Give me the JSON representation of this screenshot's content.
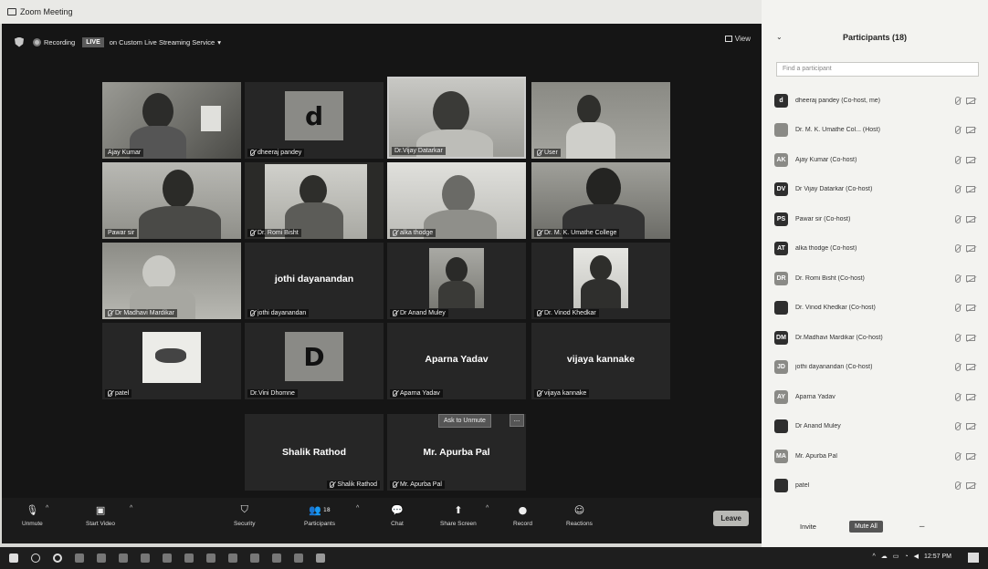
{
  "window": {
    "title": "Zoom Meeting",
    "controls": [
      "–",
      "▫",
      "×"
    ]
  },
  "topbar": {
    "recording_label": "Recording",
    "live_badge": "LIVE",
    "live_service": "on Custom Live Streaming Service",
    "view_label": "View"
  },
  "tiles": [
    {
      "name": "Ajay Kumar",
      "muted": false
    },
    {
      "name": "dheeraj pandey",
      "muted": true,
      "avatar_letter": "d"
    },
    {
      "name": "Dr.Vijay Datarkar",
      "muted": false
    },
    {
      "name": "User",
      "muted": true
    },
    {
      "name": "Pawar sir",
      "muted": false
    },
    {
      "name": "Dr. Romi Bisht",
      "muted": true
    },
    {
      "name": "alka thodge",
      "muted": true
    },
    {
      "name": "Dr. M. K. Umathe College",
      "muted": true
    },
    {
      "name": "Dr Madhavi Mardikar",
      "muted": true
    },
    {
      "name": "jothi dayanandan",
      "muted": true,
      "display_name": "jothi dayanandan"
    },
    {
      "name": "Dr Anand Muley",
      "muted": true
    },
    {
      "name": "Dr. Vinod Khedkar",
      "muted": true
    },
    {
      "name": "patel",
      "muted": true
    },
    {
      "name": "Dr.Vini Dhomne",
      "muted": false,
      "avatar_letter": "D"
    },
    {
      "name": "Aparna Yadav",
      "muted": true,
      "display_name": "Aparna Yadav"
    },
    {
      "name": "vijaya kannake",
      "muted": true,
      "display_name": "vijaya kannake"
    },
    {
      "name": "Shalik Rathod",
      "muted": true,
      "display_name": "Shalik Rathod"
    },
    {
      "name": "Mr. Apurba Pal",
      "muted": true,
      "display_name": "Mr. Apurba Pal"
    }
  ],
  "ask_unmute_label": "Ask to Unmute",
  "ask_more_label": "...",
  "toolbar": {
    "unmute": "Unmute",
    "start_video": "Start Video",
    "security": "Security",
    "participants": "Participants",
    "participants_count": "18",
    "chat": "Chat",
    "share_screen": "Share Screen",
    "record": "Record",
    "reactions": "Reactions",
    "leave": "Leave"
  },
  "panel": {
    "title": "Participants (18)",
    "search_placeholder": "Find a participant",
    "participants": [
      {
        "initials": "d",
        "name": "dheeraj pandey (Co-host, me)",
        "dark": true
      },
      {
        "initials": "",
        "name": "Dr. M. K. Umathe Col... (Host)",
        "dark": false
      },
      {
        "initials": "AK",
        "name": "Ajay Kumar (Co-host)",
        "dark": false
      },
      {
        "initials": "DV",
        "name": "Dr Vijay Datarkar (Co-host)",
        "dark": true
      },
      {
        "initials": "PS",
        "name": "Pawar sir (Co-host)",
        "dark": true
      },
      {
        "initials": "AT",
        "name": "alka thodge (Co-host)",
        "dark": true
      },
      {
        "initials": "DR",
        "name": "Dr. Romi Bisht (Co-host)",
        "dark": false
      },
      {
        "initials": "",
        "name": "Dr. Vinod Khedkar (Co-host)",
        "dark": true
      },
      {
        "initials": "DM",
        "name": "Dr.Madhavi Mardikar (Co-host)",
        "dark": true
      },
      {
        "initials": "JD",
        "name": "jothi dayanandan (Co-host)",
        "dark": false
      },
      {
        "initials": "AY",
        "name": "Aparna Yadav",
        "dark": false
      },
      {
        "initials": "",
        "name": "Dr Anand Muley",
        "dark": true
      },
      {
        "initials": "MA",
        "name": "Mr. Apurba Pal",
        "dark": false
      },
      {
        "initials": "",
        "name": "patel",
        "dark": true
      }
    ],
    "invite_label": "Invite",
    "mute_all_label": "Mute All",
    "more_label": "–"
  },
  "taskbar": {
    "time": "12:57 PM"
  }
}
